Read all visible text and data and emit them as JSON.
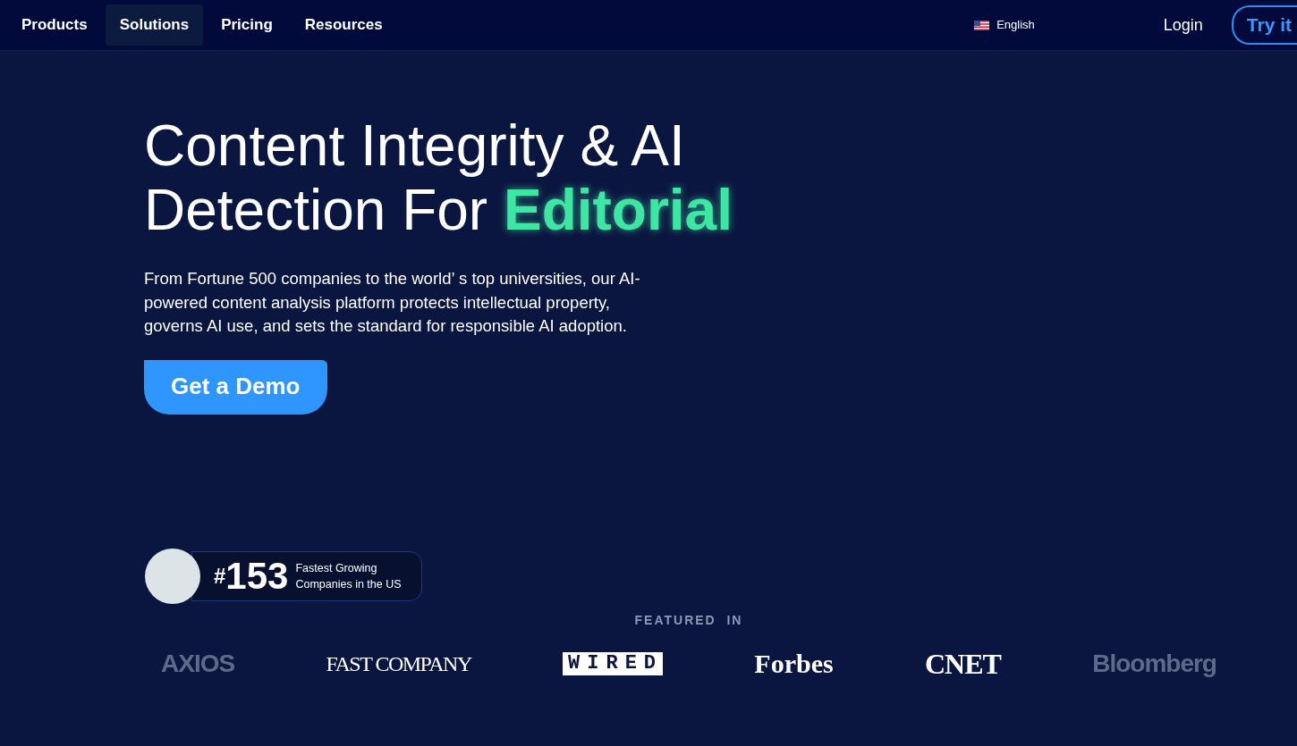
{
  "nav": {
    "items": [
      {
        "label": "Products",
        "selected": false
      },
      {
        "label": "Solutions",
        "selected": true
      },
      {
        "label": "Pricing",
        "selected": false
      },
      {
        "label": "Resources",
        "selected": false
      }
    ],
    "language": "English",
    "login": "Login",
    "cta": "Try it"
  },
  "hero": {
    "headline": "Content Integrity & AI Detection For",
    "highlight": "Editorial",
    "text": "From Fortune 500 companies to the world’ s top universities, our AI-powered content analysis platform protects intellectual property, governs AI use, and sets the standard for responsible AI adoption.",
    "button": "Get a Demo"
  },
  "award": {
    "hash": "#",
    "rank": "153",
    "caption_1": "Fastest Growing",
    "caption_2": "Companies in the US"
  },
  "featured": {
    "title": "FEATURED  IN",
    "logos": [
      {
        "label": "AXIOS",
        "kind": "sans",
        "faded": true
      },
      {
        "label": "FAST COMPANY",
        "kind": "serif-condensed",
        "faded": false
      },
      {
        "label": "WIRED",
        "kind": "boxed",
        "faded": false
      },
      {
        "label": "Forbes",
        "kind": "serif",
        "faded": false
      },
      {
        "label": "CNET",
        "kind": "slab",
        "faded": false
      },
      {
        "label": "Bloomberg",
        "kind": "sans",
        "faded": true
      }
    ]
  }
}
